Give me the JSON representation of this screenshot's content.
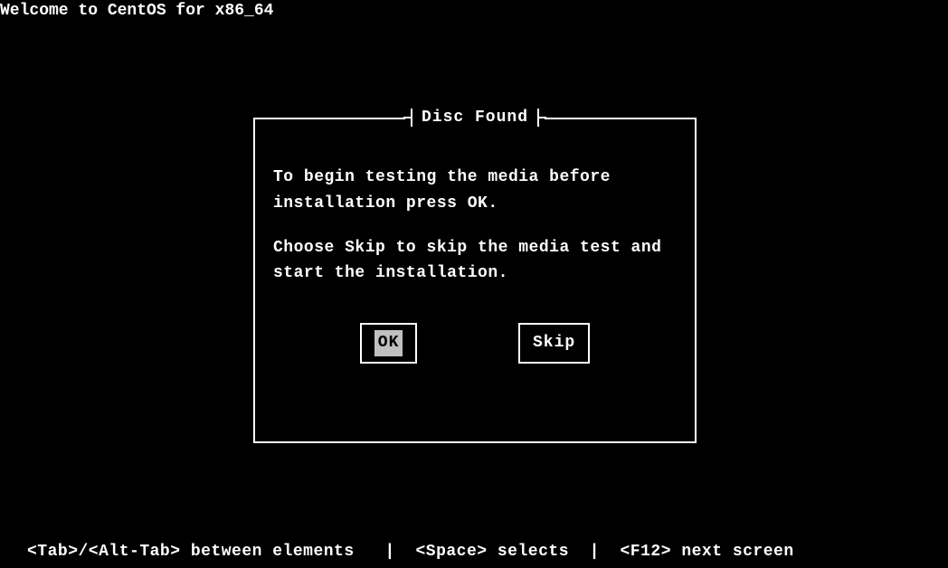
{
  "header": {
    "title": "Welcome to CentOS for x86_64"
  },
  "dialog": {
    "title": "Disc Found",
    "paragraph1": "To begin testing the media before installation press OK.",
    "paragraph2": "Choose Skip to skip the media test and start the installation.",
    "buttons": {
      "ok": "OK",
      "skip": "Skip"
    }
  },
  "footer": {
    "text": "<Tab>/<Alt-Tab> between elements   |  <Space> selects  |  <F12> next screen"
  }
}
